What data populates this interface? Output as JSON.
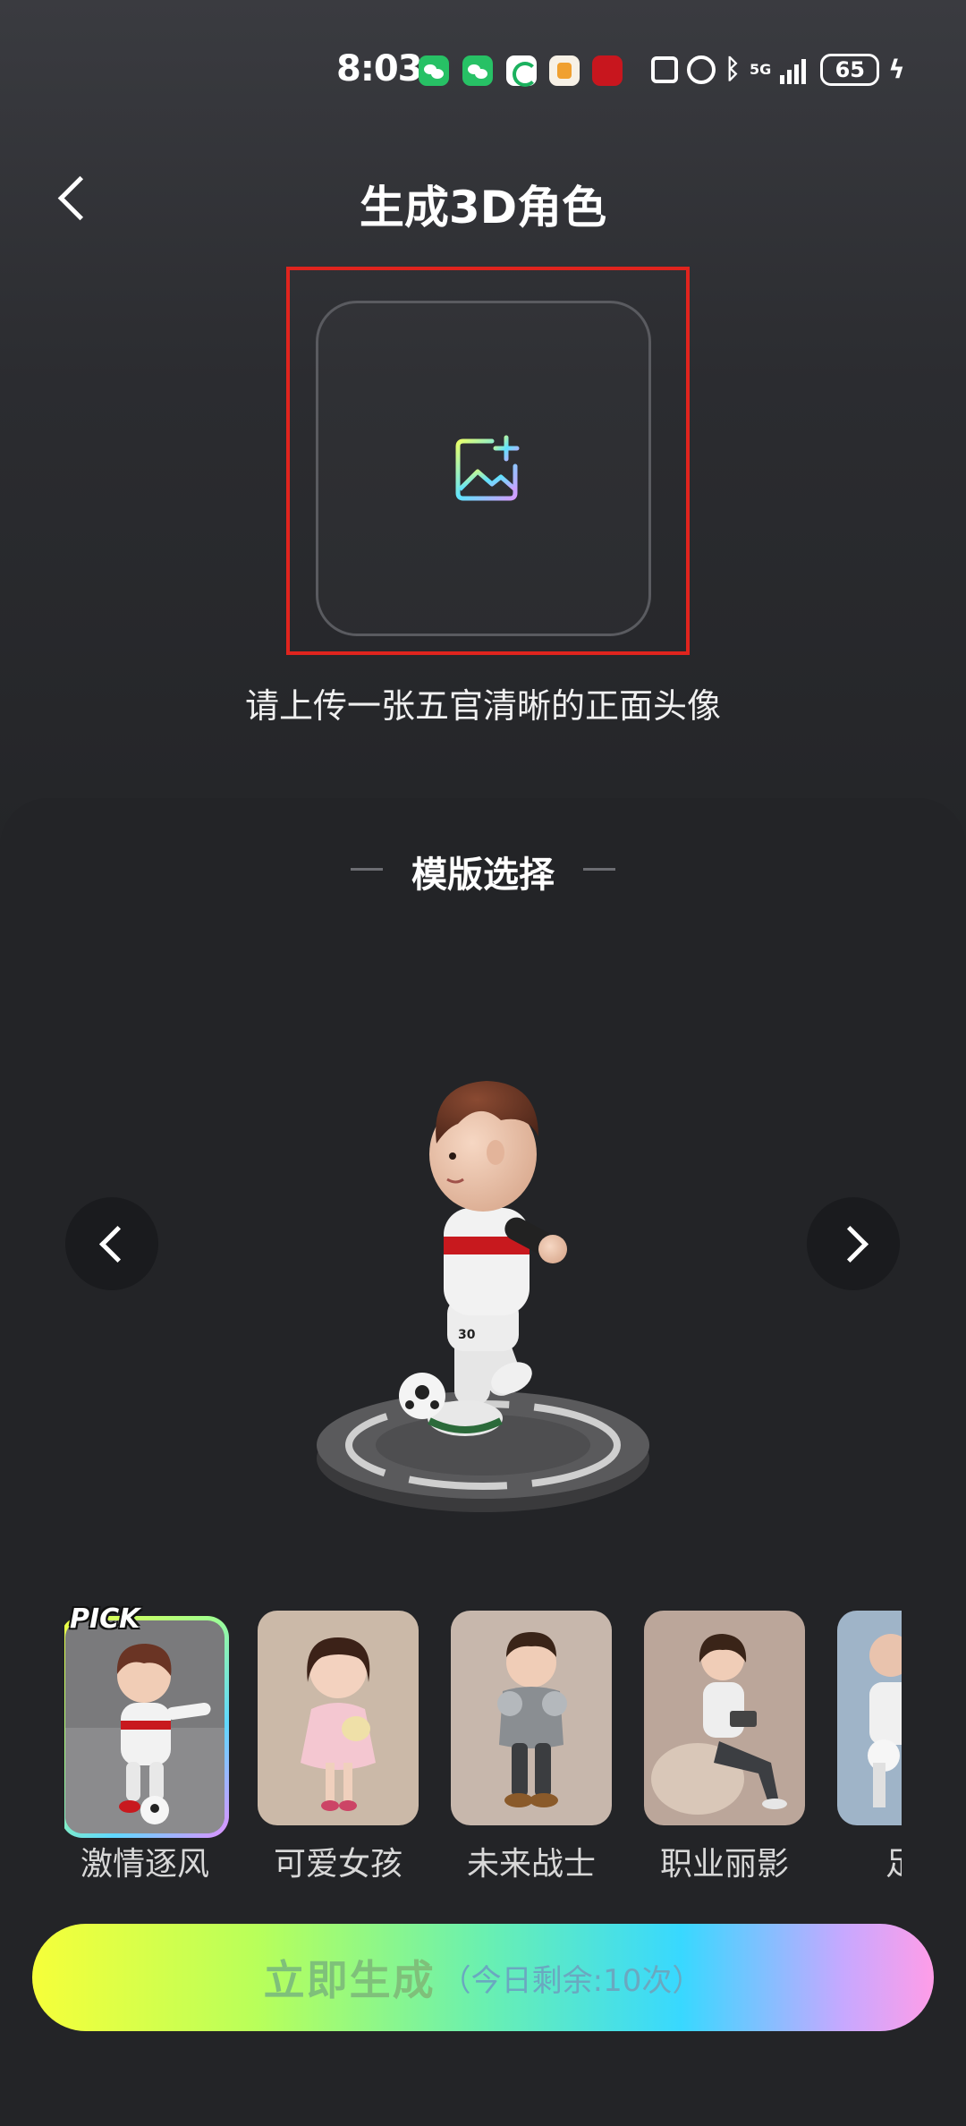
{
  "status_bar": {
    "time": "8:03",
    "battery": "65",
    "network": "5G"
  },
  "header": {
    "title": "生成3D角色"
  },
  "upload": {
    "hint": "请上传一张五官清晰的正面头像"
  },
  "templates": {
    "section_title": "模版选择",
    "pick_badge": "PICK",
    "items": [
      {
        "label": "激情逐风",
        "selected": true
      },
      {
        "label": "可爱女孩",
        "selected": false
      },
      {
        "label": "未来战士",
        "selected": false
      },
      {
        "label": "职业丽影",
        "selected": false
      },
      {
        "label": "足球",
        "selected": false
      }
    ]
  },
  "generate": {
    "label": "立即生成",
    "remaining": "（今日剩余:10次）"
  },
  "colors": {
    "highlight": "#e0241e",
    "panel": "#232427",
    "button_gradient": [
      "#f6ff3a",
      "#6af0b0",
      "#38d8ff",
      "#ff9de8"
    ]
  }
}
